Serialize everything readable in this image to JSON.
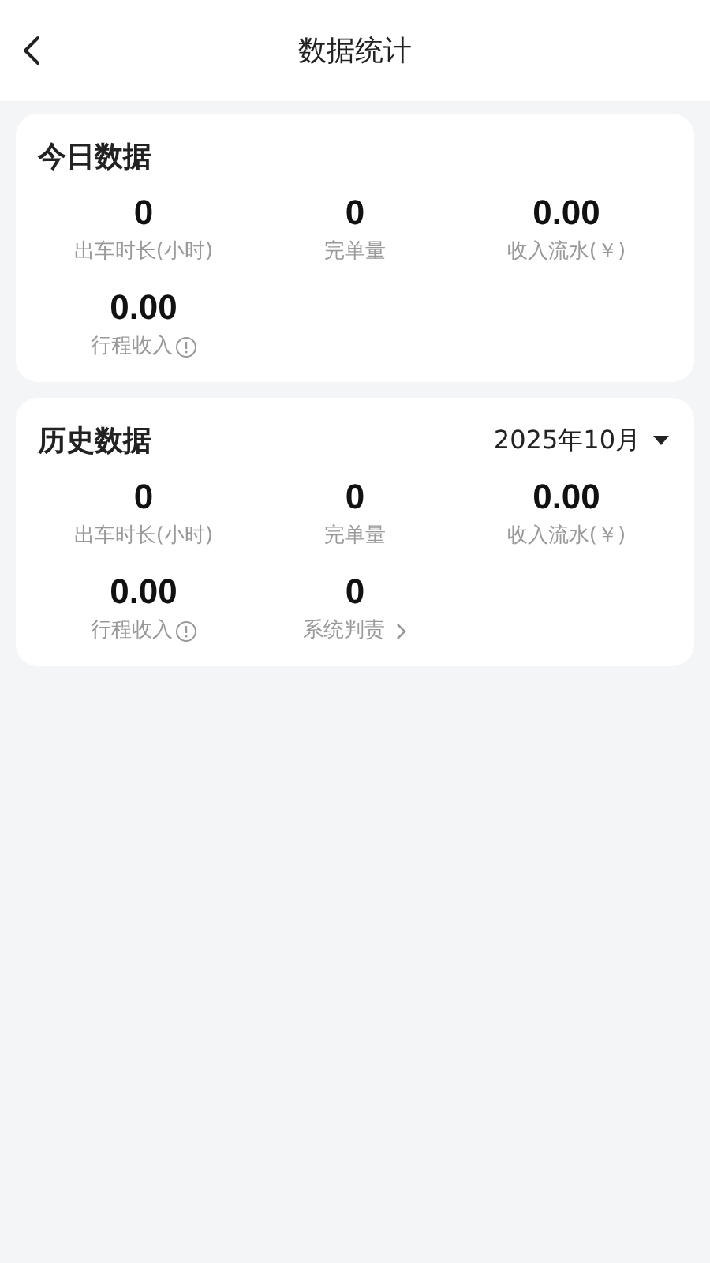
{
  "header": {
    "title": "数据统计"
  },
  "sections": [
    {
      "title": "今日数据",
      "items": [
        {
          "value": "0",
          "label": "出车时长(小时)",
          "kind": "plain"
        },
        {
          "value": "0",
          "label": "完单量",
          "kind": "plain"
        },
        {
          "value": "0.00",
          "label": "收入流水(￥)",
          "kind": "plain"
        },
        {
          "value": "0.00",
          "label": "行程收入",
          "kind": "info"
        }
      ]
    },
    {
      "title": "历史数据",
      "month_picker": "2025年10月",
      "items": [
        {
          "value": "0",
          "label": "出车时长(小时)",
          "kind": "plain"
        },
        {
          "value": "0",
          "label": "完单量",
          "kind": "plain"
        },
        {
          "value": "0.00",
          "label": "收入流水(￥)",
          "kind": "plain"
        },
        {
          "value": "0.00",
          "label": "行程收入",
          "kind": "info"
        },
        {
          "value": "0",
          "label": "系统判责",
          "kind": "link"
        }
      ]
    }
  ]
}
